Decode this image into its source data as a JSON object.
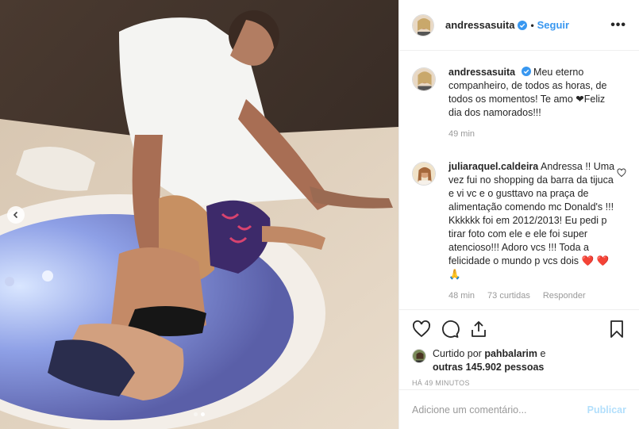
{
  "header": {
    "username": "andressasuita",
    "separator": "•",
    "follow_label": "Seguir",
    "more_label": "•••"
  },
  "caption": {
    "username": "andressasuita",
    "text": "Meu eterno companheiro, de todos as horas, de todos os momentos! Te amo ❤Feliz dia dos namorados!!!",
    "time": "49 min"
  },
  "comments": [
    {
      "username": "juliaraquel.caldeira",
      "text": "Andressa !! Uma vez fui no shopping da barra da tijuca e vi vc e o gusttavo na praça de alimentação comendo mc Donald's !!! Kkkkkk foi em 2012/2013! Eu pedi p tirar foto com ele e ele foi super atencioso!!! Adoro vcs !!! Toda a felicidade o mundo p vcs dois ❤️ ❤️🙏",
      "time": "48 min",
      "likes": "73 curtidas",
      "reply_label": "Responder"
    }
  ],
  "likes": {
    "prefix": "Curtido por",
    "user": "pahbalarim",
    "middle": "e",
    "others": "outras 145.902 pessoas"
  },
  "timestamp": "HÁ 49 MINUTOS",
  "add_comment": {
    "placeholder": "Adicione um comentário...",
    "publish_label": "Publicar"
  },
  "carousel": {
    "current": 2,
    "total": 2
  },
  "colors": {
    "accent": "#3897f0",
    "publish_disabled": "#b2dffc",
    "verified": "#3897f0",
    "heart": "#ed4956"
  }
}
